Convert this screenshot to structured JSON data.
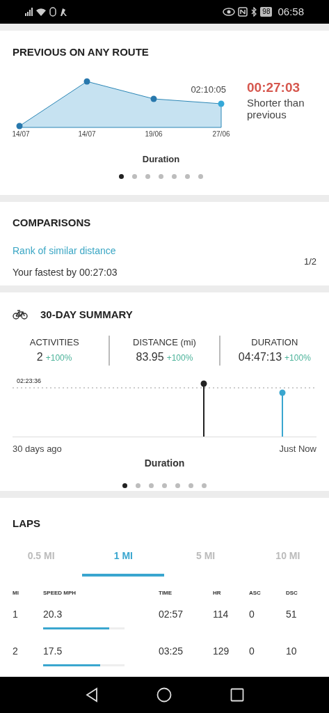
{
  "status_bar": {
    "battery": "98",
    "time": "06:58"
  },
  "previous_route": {
    "title": "PREVIOUS ON ANY ROUTE",
    "point_label": "02:10:05",
    "x_labels": [
      "14/07",
      "14/07",
      "19/06",
      "27/06"
    ],
    "difference": "00:27:03",
    "difference_note": "Shorter than previous",
    "chart_caption": "Duration",
    "pages": [
      {
        "selected": true
      },
      {
        "selected": false
      },
      {
        "selected": false
      },
      {
        "selected": false
      },
      {
        "selected": false
      },
      {
        "selected": false
      },
      {
        "selected": false
      }
    ]
  },
  "comparisons": {
    "title": "COMPARISONS",
    "link": "Rank of similar distance",
    "detail": "Your fastest by 00:27:03",
    "pager": "1/2"
  },
  "summary": {
    "title": "30-DAY SUMMARY",
    "stats": [
      {
        "label": "ACTIVITIES",
        "value": "2",
        "change": "+100%"
      },
      {
        "label": "DISTANCE (mi)",
        "value": "83.95",
        "change": "+100%"
      },
      {
        "label": "DURATION",
        "value": "04:47:13",
        "change": "+100%"
      }
    ],
    "reference_label": "02:23:36",
    "start_label": "30 days ago",
    "end_label": "Just Now",
    "chart_caption": "Duration",
    "pages": [
      {
        "selected": true
      },
      {
        "selected": false
      },
      {
        "selected": false
      },
      {
        "selected": false
      },
      {
        "selected": false
      },
      {
        "selected": false
      },
      {
        "selected": false
      }
    ]
  },
  "laps": {
    "title": "LAPS",
    "tabs": [
      {
        "label": "0.5 MI",
        "selected": false
      },
      {
        "label": "1 MI",
        "selected": true
      },
      {
        "label": "5 MI",
        "selected": false
      },
      {
        "label": "10 MI",
        "selected": false
      }
    ],
    "columns": [
      "MI",
      "SPEED MPH",
      "TIME",
      "HR",
      "ASC",
      "DSC"
    ],
    "rows": [
      {
        "mi": "1",
        "speed": "20.3",
        "level": 0.81,
        "time": "02:57",
        "hr": "114",
        "asc": "0",
        "dsc": "51"
      },
      {
        "mi": "2",
        "speed": "17.5",
        "level": 0.7,
        "time": "03:25",
        "hr": "129",
        "asc": "0",
        "dsc": "10"
      }
    ]
  }
}
